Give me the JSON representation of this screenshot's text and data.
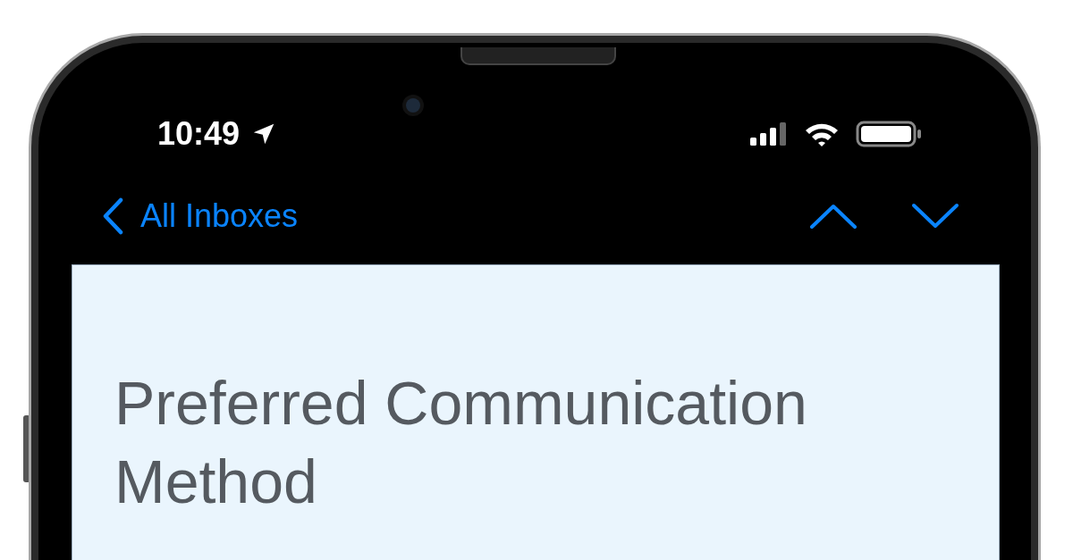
{
  "status_bar": {
    "time": "10:49"
  },
  "nav": {
    "back_label": "All Inboxes"
  },
  "email": {
    "heading": "Preferred Communication Method"
  }
}
